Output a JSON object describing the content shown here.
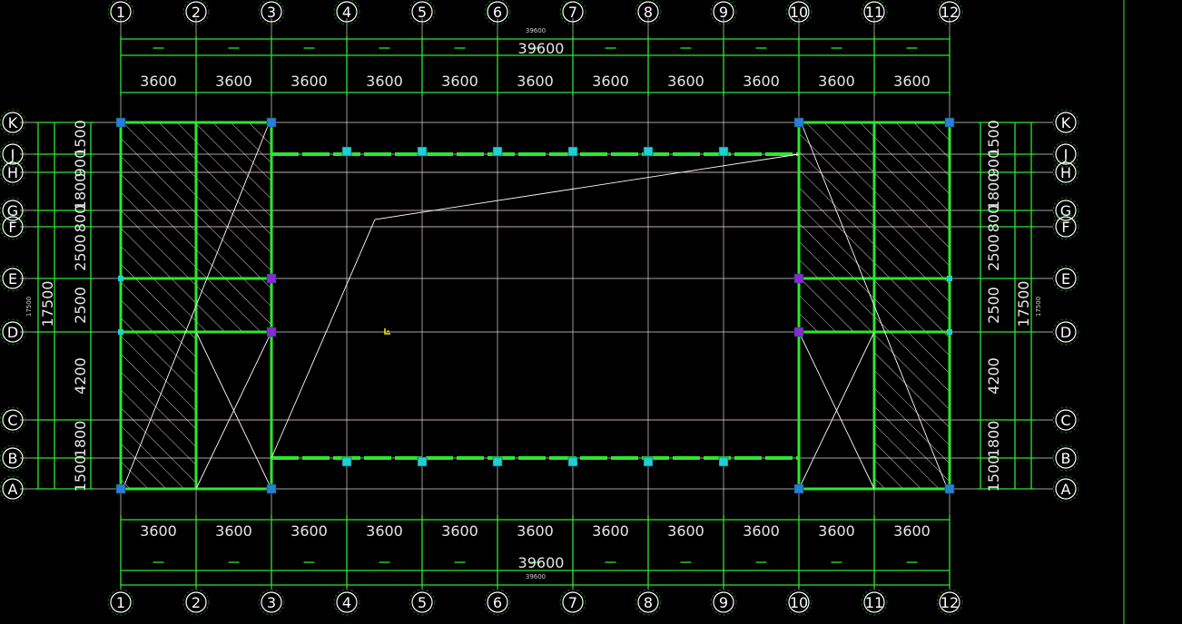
{
  "drawing": {
    "grid_columns": [
      "1",
      "2",
      "3",
      "4",
      "5",
      "6",
      "7",
      "8",
      "9",
      "10",
      "11",
      "12"
    ],
    "grid_rows": [
      "K",
      "J",
      "H",
      "G",
      "F",
      "E",
      "D",
      "C",
      "B",
      "A"
    ],
    "top_total_label": "39600",
    "top_total_small": "39600",
    "bottom_total_label": "39600",
    "bottom_total_small": "39600",
    "top_bay_labels": [
      "3600",
      "3600",
      "3600",
      "3600",
      "3600",
      "3600",
      "3600",
      "3600",
      "3600",
      "3600",
      "3600"
    ],
    "bottom_bay_labels": [
      "3600",
      "3600",
      "3600",
      "3600",
      "3600",
      "3600",
      "3600",
      "3600",
      "3600",
      "3600",
      "3600"
    ],
    "left_bay_labels": [
      "1500",
      "900",
      "1800",
      "800",
      "2500",
      "2500",
      "4200",
      "1800",
      "1500"
    ],
    "right_bay_labels": [
      "1500",
      "900",
      "1800",
      "800",
      "2500",
      "2500",
      "4200",
      "1800",
      "1500"
    ],
    "left_total_label": "17500",
    "left_total_small": "17500",
    "right_total_label": "17500",
    "right_total_small": "17500",
    "colors": {
      "background": "#000000",
      "grid": "#d8d8d8",
      "structure": "#2ee62e",
      "column_cyan": "#20d0d0",
      "column_blue": "#2a7fd4",
      "column_purple": "#8a2ad4",
      "red_line": "#d42020",
      "hatch": "#ffffff",
      "marker": "#ffee00"
    }
  }
}
